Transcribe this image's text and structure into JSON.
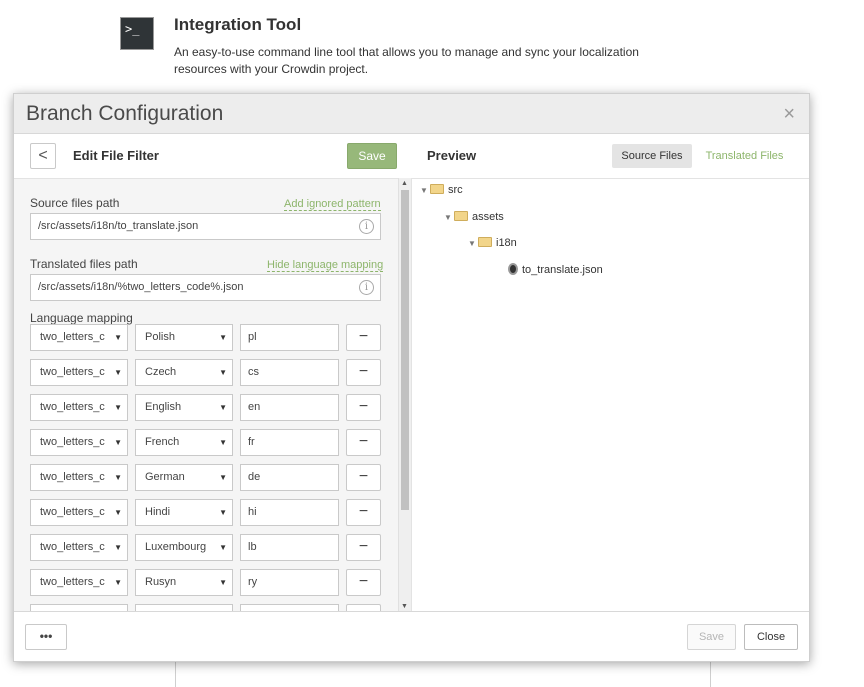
{
  "background": {
    "icon_glyph": ">_",
    "title": "Integration Tool",
    "description": "An easy-to-use command line tool that allows you to manage and sync your localization resources with your Crowdin project."
  },
  "modal": {
    "title": "Branch Configuration",
    "close_glyph": "×",
    "left": {
      "back_glyph": "<",
      "title": "Edit File Filter",
      "save_label": "Save",
      "source_label": "Source files path",
      "add_ignored_link": "Add ignored pattern",
      "source_value": "/src/assets/i18n/to_translate.json",
      "translated_label": "Translated files path",
      "hide_mapping_link": "Hide language mapping",
      "translated_value": "/src/assets/i18n/%two_letters_code%.json",
      "mapping_label": "Language mapping",
      "info_glyph": "i",
      "minus_glyph": "−",
      "dropdown_glyph": "▼",
      "mappings": [
        {
          "placeholder": "two_letters_c",
          "language": "Polish",
          "code": "pl"
        },
        {
          "placeholder": "two_letters_c",
          "language": "Czech",
          "code": "cs"
        },
        {
          "placeholder": "two_letters_c",
          "language": "English",
          "code": "en"
        },
        {
          "placeholder": "two_letters_c",
          "language": "French",
          "code": "fr"
        },
        {
          "placeholder": "two_letters_c",
          "language": "German",
          "code": "de"
        },
        {
          "placeholder": "two_letters_c",
          "language": "Hindi",
          "code": "hi"
        },
        {
          "placeholder": "two_letters_c",
          "language": "Luxembourg",
          "code": "lb"
        },
        {
          "placeholder": "two_letters_c",
          "language": "Rusyn",
          "code": "ry"
        }
      ]
    },
    "right": {
      "title": "Preview",
      "tab_source": "Source Files",
      "tab_translated": "Translated Files",
      "tree": {
        "src": "src",
        "assets": "assets",
        "i18n": "i18n",
        "file": "to_translate.json"
      },
      "caret_glyph": "▼"
    },
    "footer": {
      "more_label": "•••",
      "save_label": "Save",
      "close_label": "Close"
    },
    "scroll": {
      "up": "▲",
      "down": "▼"
    }
  },
  "colors": {
    "accent_green": "#8db56b",
    "save_button": "#97b87a",
    "header_bg": "#ededed"
  }
}
